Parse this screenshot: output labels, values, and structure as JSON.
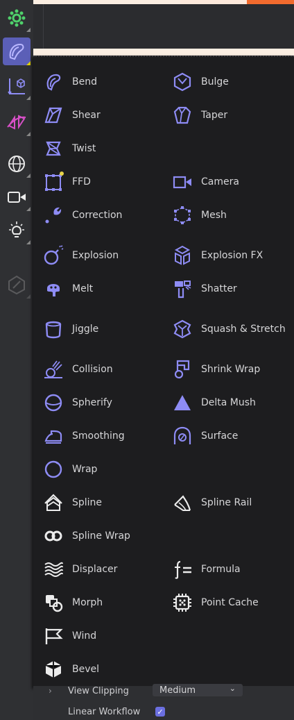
{
  "colors": {
    "accent": "#8e8cf5",
    "menu_bg": "#1d1d1f",
    "toolbar_bg": "#2f3033",
    "active_tool": "#5b5fb7",
    "green_icon": "#4fd16b",
    "orange_tab": "#f26b2e"
  },
  "toolbar": {
    "tools": [
      {
        "icon": "gear-green-icon"
      },
      {
        "icon": "deformer-icon"
      },
      {
        "icon": "cube-transform-icon"
      },
      {
        "icon": "spline-arrows-icon"
      },
      {
        "icon": "globe-icon"
      },
      {
        "icon": "camera-icon"
      },
      {
        "icon": "light-bulb-icon"
      },
      {
        "icon": "disabled-tool-icon"
      }
    ]
  },
  "menu": {
    "left": [
      {
        "label": "Bend",
        "icon": "bend-icon"
      },
      {
        "label": "Shear",
        "icon": "shear-icon"
      },
      {
        "label": "Twist",
        "icon": "twist-icon"
      },
      {
        "label": "FFD",
        "icon": "ffd-icon"
      },
      {
        "label": "Correction",
        "icon": "wrench-icon"
      },
      {
        "label": "Explosion",
        "icon": "bomb-icon"
      },
      {
        "label": "Melt",
        "icon": "melt-icon"
      },
      {
        "label": "Jiggle",
        "icon": "jiggle-icon"
      },
      {
        "label": "Collision",
        "icon": "collision-icon"
      },
      {
        "label": "Spherify",
        "icon": "spherify-icon"
      },
      {
        "label": "Smoothing",
        "icon": "iron-icon"
      },
      {
        "label": "Wrap",
        "icon": "wrap-icon"
      },
      {
        "label": "Spline",
        "icon": "spline-icon"
      },
      {
        "label": "Spline Wrap",
        "icon": "spline-wrap-icon"
      },
      {
        "label": "Displacer",
        "icon": "waves-icon"
      },
      {
        "label": "Morph",
        "icon": "morph-icon"
      },
      {
        "label": "Wind",
        "icon": "flag-icon"
      },
      {
        "label": "Bevel",
        "icon": "bevel-icon"
      }
    ],
    "right": [
      {
        "label": "Bulge",
        "icon": "bulge-icon",
        "row": 0
      },
      {
        "label": "Taper",
        "icon": "taper-icon",
        "row": 1
      },
      {
        "label": "Camera",
        "icon": "camera-icon",
        "row": 3
      },
      {
        "label": "Mesh",
        "icon": "mesh-icon",
        "row": 4
      },
      {
        "label": "Explosion FX",
        "icon": "explosion-fx-icon",
        "row": 5
      },
      {
        "label": "Shatter",
        "icon": "shatter-icon",
        "row": 6
      },
      {
        "label": "Squash & Stretch",
        "icon": "squash-icon",
        "row": 7
      },
      {
        "label": "Shrink Wrap",
        "icon": "shrink-wrap-icon",
        "row": 8
      },
      {
        "label": "Delta Mush",
        "icon": "delta-icon",
        "row": 9
      },
      {
        "label": "Surface",
        "icon": "surface-icon",
        "row": 10
      },
      {
        "label": "Spline Rail",
        "icon": "spline-rail-icon",
        "row": 12
      },
      {
        "label": "Formula",
        "icon": "formula-icon",
        "row": 14
      },
      {
        "label": "Point Cache",
        "icon": "point-cache-icon",
        "row": 15
      }
    ]
  },
  "bottom": {
    "view_clipping_label": "View Clipping",
    "view_clipping_value": "Medium",
    "linear_workflow_label": "Linear Workflow",
    "linear_workflow_checked": true
  }
}
